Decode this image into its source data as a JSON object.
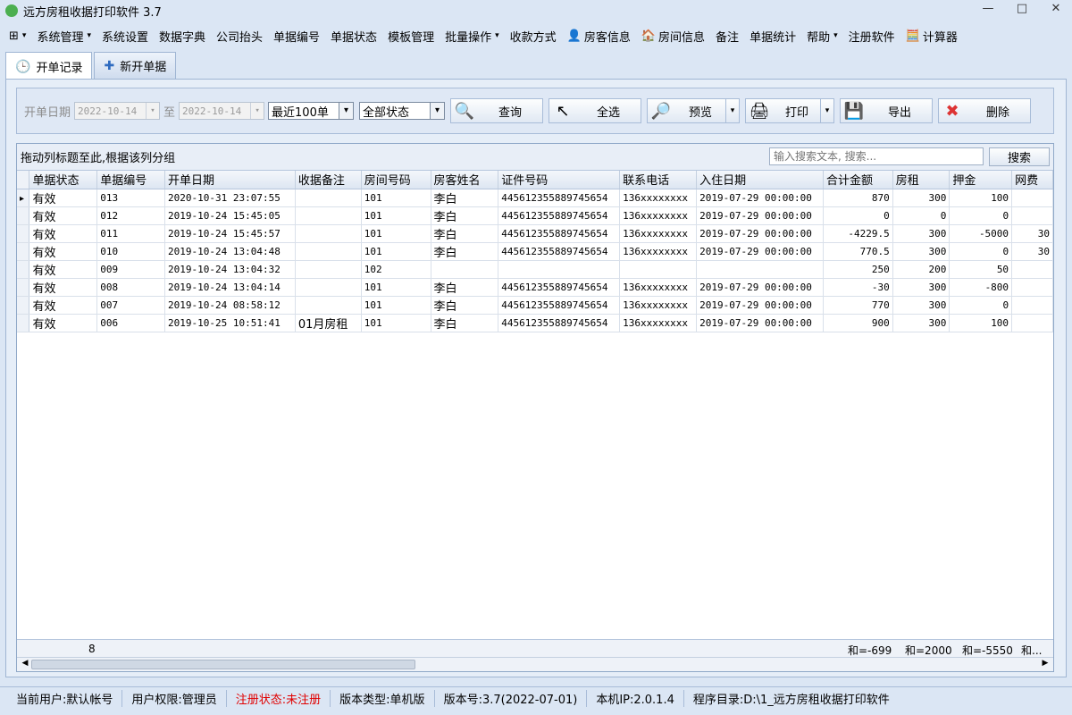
{
  "window": {
    "title": "远方房租收据打印软件 3.7",
    "controls": [
      "—",
      "□",
      "✕"
    ]
  },
  "menu": [
    {
      "label": "系统管理",
      "caret": true,
      "icon": ""
    },
    {
      "label": "系统设置",
      "caret": false,
      "icon": ""
    },
    {
      "label": "数据字典",
      "caret": false,
      "icon": ""
    },
    {
      "label": "公司抬头",
      "caret": false,
      "icon": ""
    },
    {
      "label": "单据编号",
      "caret": false,
      "icon": ""
    },
    {
      "label": "单据状态",
      "caret": false,
      "icon": ""
    },
    {
      "label": "模板管理",
      "caret": false,
      "icon": ""
    },
    {
      "label": "批量操作",
      "caret": true,
      "icon": ""
    },
    {
      "label": "收款方式",
      "caret": false,
      "icon": ""
    },
    {
      "label": "房客信息",
      "caret": false,
      "icon": "👤"
    },
    {
      "label": "房间信息",
      "caret": false,
      "icon": "🏠"
    },
    {
      "label": "备注",
      "caret": false,
      "icon": ""
    },
    {
      "label": "单据统计",
      "caret": false,
      "icon": ""
    },
    {
      "label": "帮助",
      "caret": true,
      "icon": ""
    },
    {
      "label": "注册软件",
      "caret": false,
      "icon": ""
    },
    {
      "label": "计算器",
      "caret": false,
      "icon": "🧮"
    }
  ],
  "tabs": [
    {
      "label": "开单记录",
      "icon": "🕒"
    },
    {
      "label": "新开单据",
      "icon": "✚"
    }
  ],
  "filter": {
    "date_label": "开单日期",
    "date_from": "2022-10-14",
    "to_label": "至",
    "date_to": "2022-10-14",
    "range_value": "最近100单",
    "status_value": "全部状态",
    "buttons": {
      "query": "查询",
      "select_all": "全选",
      "preview": "预览",
      "print": "打印",
      "export": "导出",
      "delete": "删除"
    }
  },
  "grid": {
    "group_hint": "拖动列标题至此,根据该列分组",
    "search_placeholder": "输入搜索文本, 搜索...",
    "search_button": "搜索",
    "columns": [
      "单据状态",
      "单据编号",
      "开单日期",
      "收据备注",
      "房间号码",
      "房客姓名",
      "证件号码",
      "联系电话",
      "入住日期",
      "合计金额",
      "房租",
      "押金",
      "网费"
    ],
    "rows": [
      [
        "有效",
        "013",
        "2020-10-31 23:07:55",
        "",
        "101",
        "李白",
        "445612355889745654",
        "136xxxxxxxx",
        "2019-07-29 00:00:00",
        "870",
        "300",
        "100",
        ""
      ],
      [
        "有效",
        "012",
        "2019-10-24 15:45:05",
        "",
        "101",
        "李白",
        "445612355889745654",
        "136xxxxxxxx",
        "2019-07-29 00:00:00",
        "0",
        "0",
        "0",
        ""
      ],
      [
        "有效",
        "011",
        "2019-10-24 15:45:57",
        "",
        "101",
        "李白",
        "445612355889745654",
        "136xxxxxxxx",
        "2019-07-29 00:00:00",
        "-4229.5",
        "300",
        "-5000",
        "30"
      ],
      [
        "有效",
        "010",
        "2019-10-24 13:04:48",
        "",
        "101",
        "李白",
        "445612355889745654",
        "136xxxxxxxx",
        "2019-07-29 00:00:00",
        "770.5",
        "300",
        "0",
        "30"
      ],
      [
        "有效",
        "009",
        "2019-10-24 13:04:32",
        "",
        "102",
        "",
        "",
        "",
        "",
        "250",
        "200",
        "50",
        ""
      ],
      [
        "有效",
        "008",
        "2019-10-24 13:04:14",
        "",
        "101",
        "李白",
        "445612355889745654",
        "136xxxxxxxx",
        "2019-07-29 00:00:00",
        "-30",
        "300",
        "-800",
        ""
      ],
      [
        "有效",
        "007",
        "2019-10-24 08:58:12",
        "",
        "101",
        "李白",
        "445612355889745654",
        "136xxxxxxxx",
        "2019-07-29 00:00:00",
        "770",
        "300",
        "0",
        ""
      ],
      [
        "有效",
        "006",
        "2019-10-25 10:51:41",
        "01月房租",
        "101",
        "李白",
        "445612355889745654",
        "136xxxxxxxx",
        "2019-07-29 00:00:00",
        "900",
        "300",
        "100",
        ""
      ]
    ],
    "footer": {
      "count": "8",
      "sum_total": "和=-699",
      "sum_rent": "和=2000",
      "sum_deposit": "和=-5550",
      "sum_more": "和..."
    }
  },
  "status": {
    "user": "当前用户:默认帐号",
    "role": "用户权限:管理员",
    "reg": "注册状态:未注册",
    "edition": "版本类型:单机版",
    "version": "版本号:3.7(2022-07-01)",
    "ip": "本机IP:2.0.1.4",
    "dir": "程序目录:D:\\1_远方房租收据打印软件"
  },
  "colors": {
    "accent": "#2e6bc0",
    "warning": "#e00000",
    "background": "#dbe6f4"
  }
}
